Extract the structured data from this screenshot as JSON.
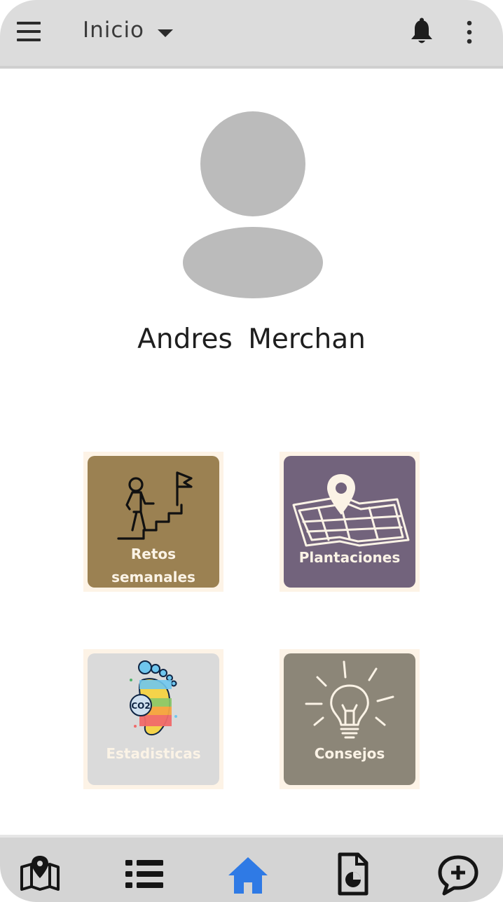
{
  "header": {
    "title": "Inicio"
  },
  "profile": {
    "name": "Andres  Merchan"
  },
  "tiles": {
    "retos": {
      "line1": "Retos",
      "line2": "semanales"
    },
    "plantaciones": {
      "label": "Plantaciones"
    },
    "estadisticas": {
      "label": "Estadisticas",
      "co2": "CO2"
    },
    "consejos": {
      "label": "Consejos"
    }
  },
  "colors": {
    "top_bar": "#dcdcdc",
    "bottom_bar": "#d4d4d4",
    "active_nav": "#2f7ae5",
    "avatar": "#bbbbbb",
    "retos_tile": "#9b8152",
    "plantaciones_tile": "#72637c",
    "estadisticas_tile": "#dadada",
    "consejos_tile": "#8c8678"
  },
  "bottom_nav": {
    "items": [
      "map-pin-icon",
      "list-icon",
      "home-icon",
      "report-document-icon",
      "add-comment-icon"
    ],
    "active": "home-icon"
  }
}
